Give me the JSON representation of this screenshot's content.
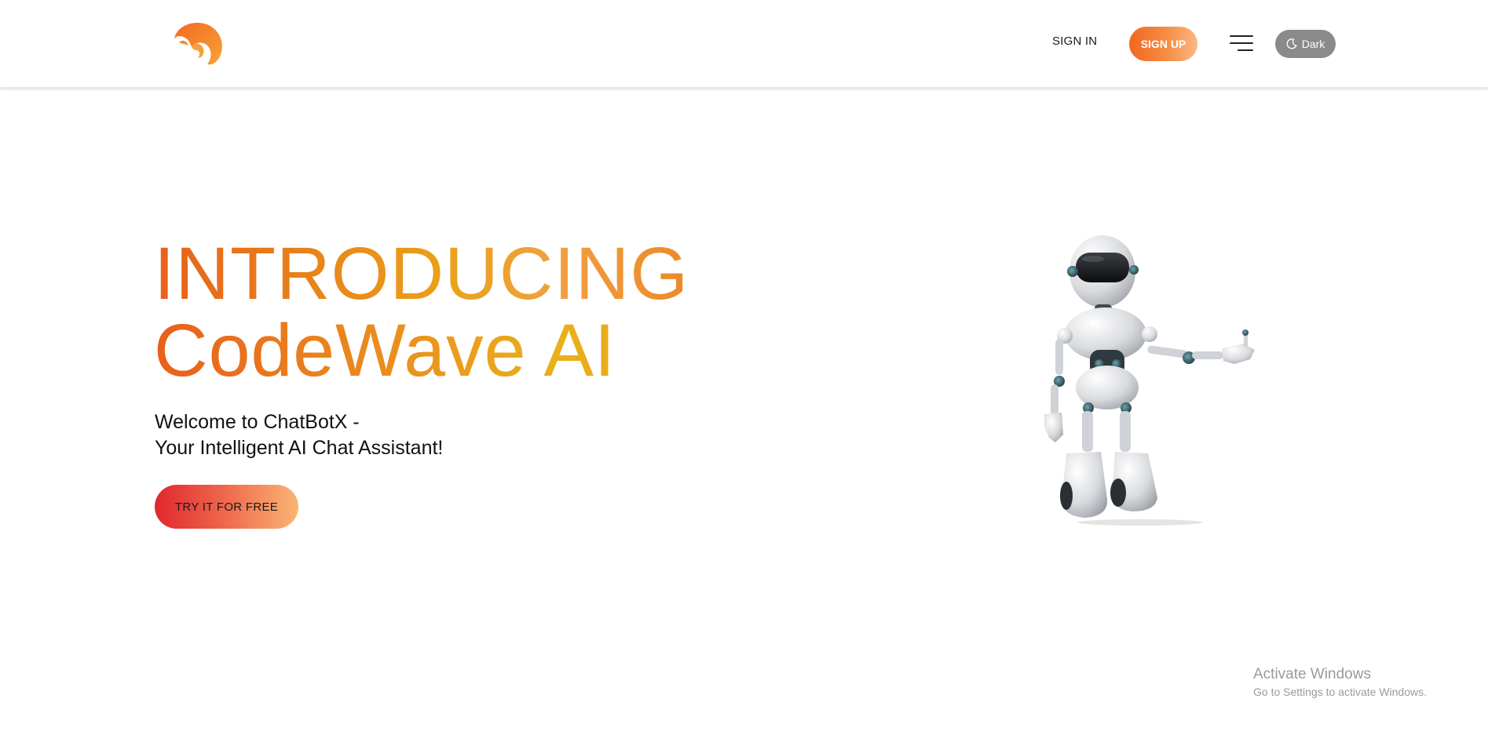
{
  "header": {
    "logo_icon": "flame-swirl-logo-icon",
    "signin_label": "SIGN IN",
    "signup_label": "SIGN UP",
    "menu_icon": "hamburger-menu-icon",
    "dark_label": "Dark",
    "dark_icon": "moon-icon"
  },
  "hero": {
    "title_line1": "INTRODUCING",
    "title_line2": "CodeWave AI",
    "subtitle_line1": "Welcome to ChatBotX -",
    "subtitle_line2": "Your Intelligent AI Chat Assistant!",
    "cta_label": "TRY IT FOR FREE",
    "image": "robot-illustration"
  },
  "watermark": {
    "title": "Activate Windows",
    "subtitle": "Go to Settings to activate Windows."
  },
  "colors": {
    "accent_orange": "#f2661f",
    "accent_light": "#fbb784",
    "title_gold": "#e9a21a",
    "cta_red": "#e0272e",
    "dark_toggle_bg": "#8a8a8a"
  }
}
